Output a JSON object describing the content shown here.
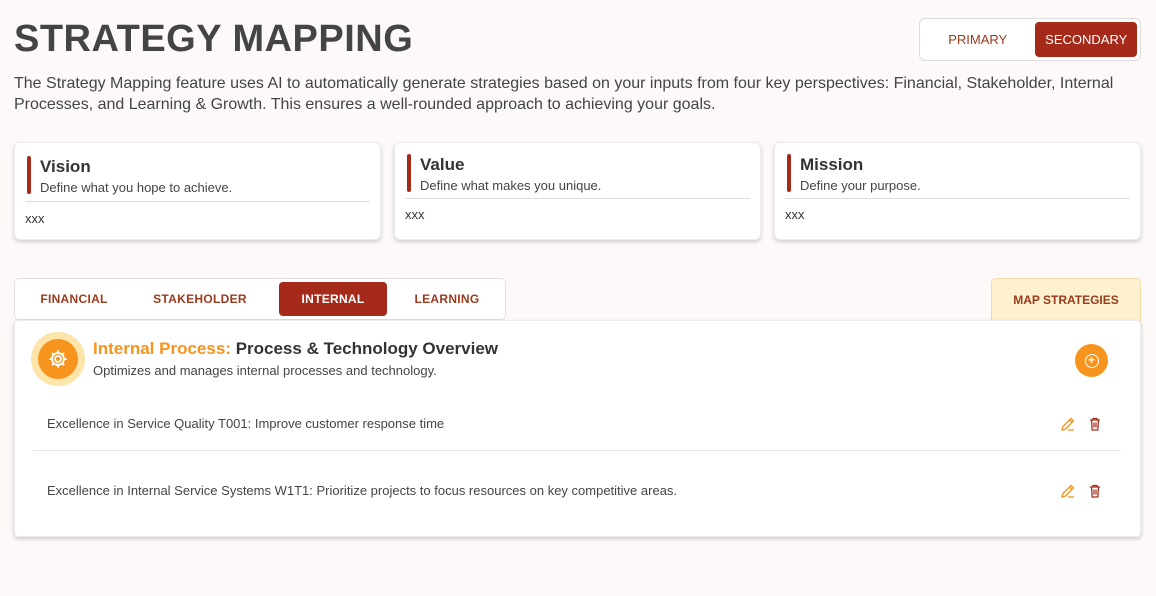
{
  "header": {
    "title": "STRATEGY MAPPING",
    "description": "The Strategy Mapping feature uses AI to automatically generate strategies based on your inputs from four key perspectives: Financial, Stakeholder, Internal Processes, and Learning & Growth. This ensures a well-rounded approach to achieving your goals."
  },
  "toggle": {
    "primary": "PRIMARY",
    "secondary": "SECONDARY",
    "selected": "SECONDARY"
  },
  "cards": [
    {
      "title": "Vision",
      "subtitle": "Define what you hope to achieve.",
      "value": "xxx"
    },
    {
      "title": "Value",
      "subtitle": "Define what makes you unique.",
      "value": "xxx"
    },
    {
      "title": "Mission",
      "subtitle": "Define your purpose.",
      "value": "xxx"
    }
  ],
  "tabs": [
    {
      "label": "FINANCIAL"
    },
    {
      "label": "STAKEHOLDER"
    },
    {
      "label": "INTERNAL"
    },
    {
      "label": "LEARNING"
    }
  ],
  "active_tab": "INTERNAL",
  "map_button": "MAP STRATEGIES",
  "panel": {
    "title_prefix": "Internal Process:",
    "title": "Process & Technology Overview",
    "subtitle": "Optimizes and manages internal processes and technology.",
    "icon": "gear-icon",
    "items": [
      {
        "text": "Excellence in Service Quality T001: Improve customer response time"
      },
      {
        "text": "Excellence in Internal Service Systems W1T1: Prioritize projects to focus resources on key competitive areas."
      }
    ]
  },
  "colors": {
    "brand": "#a52a1a",
    "accent": "#f7941d",
    "map_button_bg": "#fdf1cf"
  }
}
